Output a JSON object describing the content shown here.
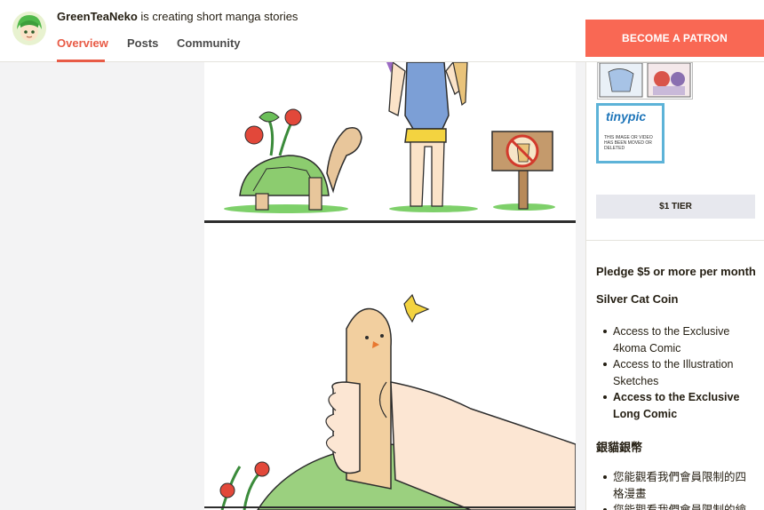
{
  "header": {
    "creator_name": "GreenTeaNeko",
    "creator_tagline": " is creating short manga stories",
    "tabs": [
      {
        "label": "Overview",
        "active": true
      },
      {
        "label": "Posts",
        "active": false
      },
      {
        "label": "Community",
        "active": false
      }
    ],
    "become_label": "BECOME A PATRON"
  },
  "colors": {
    "accent": "#f96854",
    "tab_active": "#e85b46",
    "tier_button_bg": "#e7e8ee",
    "tinypic_border": "#5db3d8"
  },
  "sidebar": {
    "tinypic": {
      "logo": "tinypic",
      "message": "THIS IMAGE OR VIDEO HAS BEEN MOVED OR DELETED"
    },
    "tier_button_label": "$1 TIER",
    "pledge_text": "Pledge $5 or more per month",
    "tier_name": "Silver Cat Coin",
    "benefits": [
      {
        "text": "Access to the Exclusive 4koma Comic",
        "bold": false
      },
      {
        "text": "Access to the Illustration Sketches",
        "bold": false
      },
      {
        "text": "Access to the Exclusive Long Comic",
        "bold": true
      }
    ],
    "cn_title": "銀貓銀幣",
    "cn_benefits": [
      "您能觀看我們會員限制的四格漫畫",
      "您能觀看我們會員限制的繪畫"
    ]
  },
  "comic": {
    "icons": [
      "tortoise-with-tomato-plant",
      "girl-holding-corn",
      "no-corn-sign",
      "corn-character-in-hand",
      "tomato-plant"
    ]
  }
}
